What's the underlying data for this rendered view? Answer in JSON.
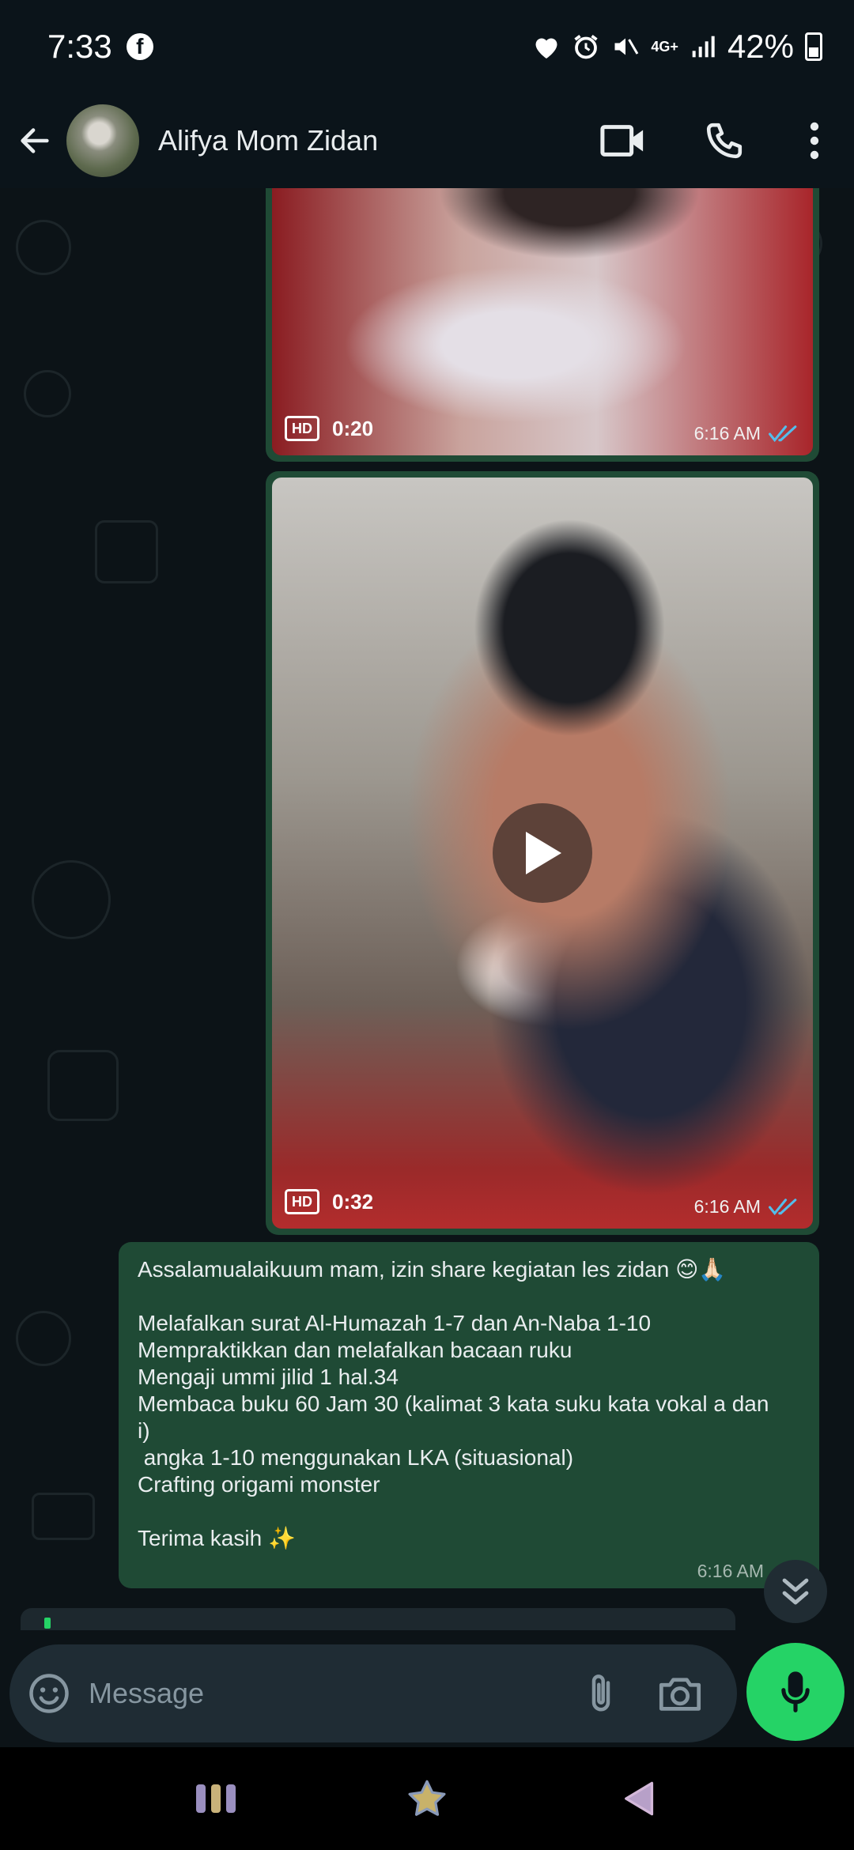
{
  "status_bar": {
    "time": "7:33",
    "notification_icon": "facebook-icon",
    "network": "4G+",
    "battery": "42%"
  },
  "header": {
    "back_icon": "arrow-left-icon",
    "contact_name": "Alifya Mom Zidan",
    "video_call_icon": "video-camera-icon",
    "voice_call_icon": "phone-icon",
    "menu_icon": "more-vertical-icon"
  },
  "messages": [
    {
      "type": "video",
      "badge": "HD",
      "duration": "0:20",
      "time": "6:16 AM",
      "status": "read"
    },
    {
      "type": "video",
      "badge": "HD",
      "duration": "0:32",
      "time": "6:16 AM",
      "status": "read"
    },
    {
      "type": "text",
      "lines": [
        "Assalamualaikuum mam, izin share kegiatan les zidan 😊🙏🏻",
        "",
        "Melafalkan surat Al-Humazah 1-7 dan An-Naba 1-10",
        "Mempraktikkan dan melafalkan bacaan ruku",
        "Mengaji ummi jilid 1 hal.34",
        "Membaca buku 60 Jam 30 (kalimat 3 kata suku kata vokal a dan",
        "i)",
        " angka 1-10 menggunakan LKA (situasional)",
        "Crafting origami monster",
        "",
        "Terima kasih ✨"
      ],
      "time": "6:16 AM"
    }
  ],
  "upload_progress": 0.01,
  "composer": {
    "placeholder": "Message",
    "emoji_icon": "emoji-icon",
    "attach_icon": "paperclip-icon",
    "camera_icon": "camera-icon",
    "mic_icon": "microphone-icon"
  },
  "nav_bar": {
    "recents_icon": "recent-apps-icon",
    "home_icon": "home-star-icon",
    "back_icon": "nav-back-icon"
  },
  "colors": {
    "background": "#0b141a",
    "outgoing_bubble": "#1f4a35",
    "accent": "#25d366",
    "read_ticks": "#53bdeb"
  }
}
